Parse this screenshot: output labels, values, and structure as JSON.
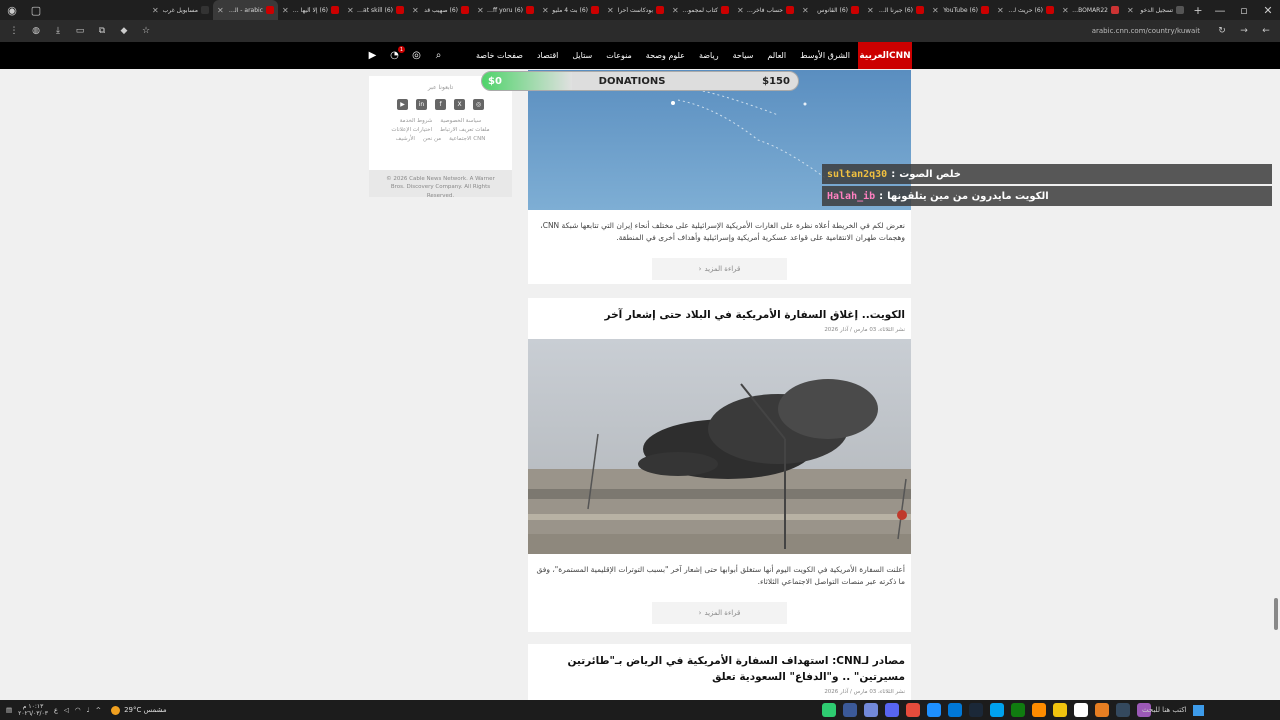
{
  "browser": {
    "tabs": [
      {
        "label": "تسجيل الدخو",
        "color": "#555555"
      },
      {
        "label": "BOBOMAR22",
        "color": "#cc3333"
      },
      {
        "label": "(6) حريث لعب",
        "color": "#cc0000"
      },
      {
        "label": "YouTube (6)",
        "color": "#cc0000"
      },
      {
        "label": "(6) جبرنا القوي",
        "color": "#cc0000"
      },
      {
        "label": "(6) القانوس",
        "color": "#cc0000"
      },
      {
        "label": "حساب فاخر مت",
        "color": "#cc0000"
      },
      {
        "label": "كتاب لمجموعة",
        "color": "#cc0000"
      },
      {
        "label": "بودكاست أحرا",
        "color": "#cc0000"
      },
      {
        "label": "(6) بث 4 مليو",
        "color": "#cc0000"
      },
      {
        "label": "Tariff yoru (6)",
        "color": "#cc0000"
      },
      {
        "label": "(6) صهيب قد",
        "color": "#cc0000"
      },
      {
        "label": "Great skill (6)",
        "color": "#cc0000"
      },
      {
        "label": "(6) إلا أليها الرا",
        "color": "#cc0000"
      },
      {
        "label": "arabic - الكويت",
        "color": "#cc0000",
        "active": true
      },
      {
        "label": "مسابويل غرب",
        "color": "#333333"
      }
    ],
    "new_tab": "+",
    "url": "arabic.cnn.com/country/kuwait"
  },
  "nav": {
    "logo": "العربيةCNN",
    "links": [
      "الشرق الأوسط",
      "العالم",
      "سياحة",
      "رياضة",
      "علوم وصحة",
      "منوعات",
      "ستايل",
      "اقتصاد",
      "صفحات خاصة"
    ],
    "notification_count": "1"
  },
  "sidebar": {
    "follow_label": "تابعونا عبر",
    "socials": [
      "instagram",
      "x",
      "facebook",
      "linkedin",
      "youtube"
    ],
    "legal_links": [
      "سياسة الخصوصية",
      "شروط الخدمة",
      "ملفات تعريف الارتباط",
      "اختيارات الإعلانات",
      "CNN الاجتماعية",
      "من نحن",
      "الأرشيف"
    ],
    "copyright": "© 2026 Cable News Network. A Warner Bros. Discovery Company. All Rights Reserved."
  },
  "articles": [
    {
      "title": "",
      "date": "",
      "description": "نعرض لكم في الخريطة أعلاه نظرة على الغارات الأمريكية الإسرائيلية على مختلف أنحاء إيران التي تتابعها شبكة CNN، وهجمات طهران الانتقامية على قواعد عسكرية أمريكية وإسرائيلية وأهداف أخرى في المنطقة.",
      "more": "قراءة المزيد"
    },
    {
      "title": "الكويت.. إغلاق السفارة الأمريكية في البلاد حتى إشعار آخر",
      "date": "نشر الثلاثاء، 03 مارس / آذار 2026",
      "description": "أعلنت السفارة الأمريكية في الكويت اليوم أنها ستغلق أبوابها حتى إشعار آخر \"بسبب التوترات الإقليمية المستمرة\"، وفق ما ذكرته عبر منصات التواصل الاجتماعي الثلاثاء.",
      "more": "قراءة المزيد"
    },
    {
      "title": "مصادر لـCNN: استهداف السفارة الأمريكية في الرياض بـ\"طائرتين مسيرتين\" .. و\"الدفاع\" السعودية تعلق",
      "date": "نشر الثلاثاء، 03 مارس / آذار 2026"
    }
  ],
  "overlays": {
    "donations": {
      "current": "$0",
      "label": "DONATIONS",
      "goal": "$150",
      "progress_fraction": 0
    },
    "chat": [
      {
        "user": "sultan2q30",
        "user_color": "#f0c040",
        "sep": ":",
        "message": "خلص الصوت"
      },
      {
        "user": "Halah_ib",
        "user_color": "#ff80c0",
        "sep": ":",
        "message": "الكويت مايدرون من مين يتلقونها"
      }
    ]
  },
  "taskbar": {
    "search_placeholder": "اكتب هنا للبحث",
    "weather": "29°C  مشمس",
    "time": "١٠:١٣ م",
    "date": "٢٠٢٦/٠٣/٠٣",
    "apps": [
      "#2ecc71",
      "#3b5998",
      "#7289da",
      "#5865f2",
      "#e74c3c",
      "#1e90ff",
      "#0078d7",
      "#1b2838",
      "#00a2ed",
      "#107c10",
      "#ff8c00",
      "#f1c40f",
      "#ffffff",
      "#e67e22",
      "#34495e",
      "#9b59b6"
    ]
  },
  "colors": {
    "brand": "#cc0000",
    "nav_bg": "#000000",
    "page_bg": "#f0f0f0"
  }
}
